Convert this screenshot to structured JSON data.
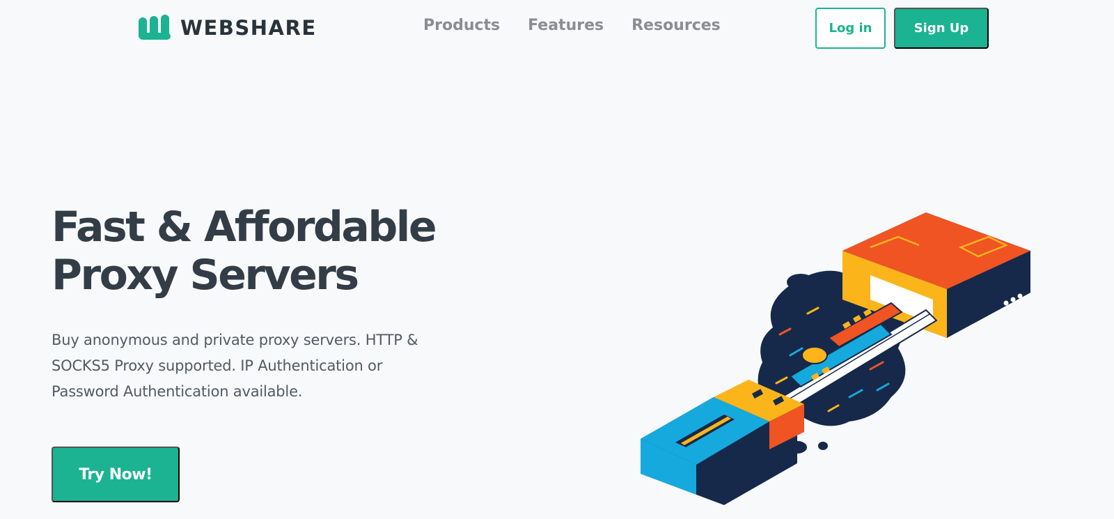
{
  "brand": {
    "name": "WEBSHARE",
    "accent_color": "#1bb391",
    "text_color": "#29333c"
  },
  "nav": {
    "items": [
      {
        "label": "Products"
      },
      {
        "label": "Features"
      },
      {
        "label": "Resources"
      }
    ]
  },
  "header_actions": {
    "login_label": "Log in",
    "signup_label": "Sign Up"
  },
  "hero": {
    "title_line1": "Fast & Affordable",
    "title_line2": "Proxy Servers",
    "subtitle": "Buy anonymous and private proxy servers. HTTP & SOCKS5 Proxy supported. IP Authentication or Password Authentication available.",
    "cta_label": "Try Now!"
  },
  "illustration": {
    "icon": "usb-proxy-illustration-icon",
    "colors": {
      "orange": "#f05423",
      "yellow": "#fbb51b",
      "navy": "#16294a",
      "blue": "#16a9de"
    }
  }
}
